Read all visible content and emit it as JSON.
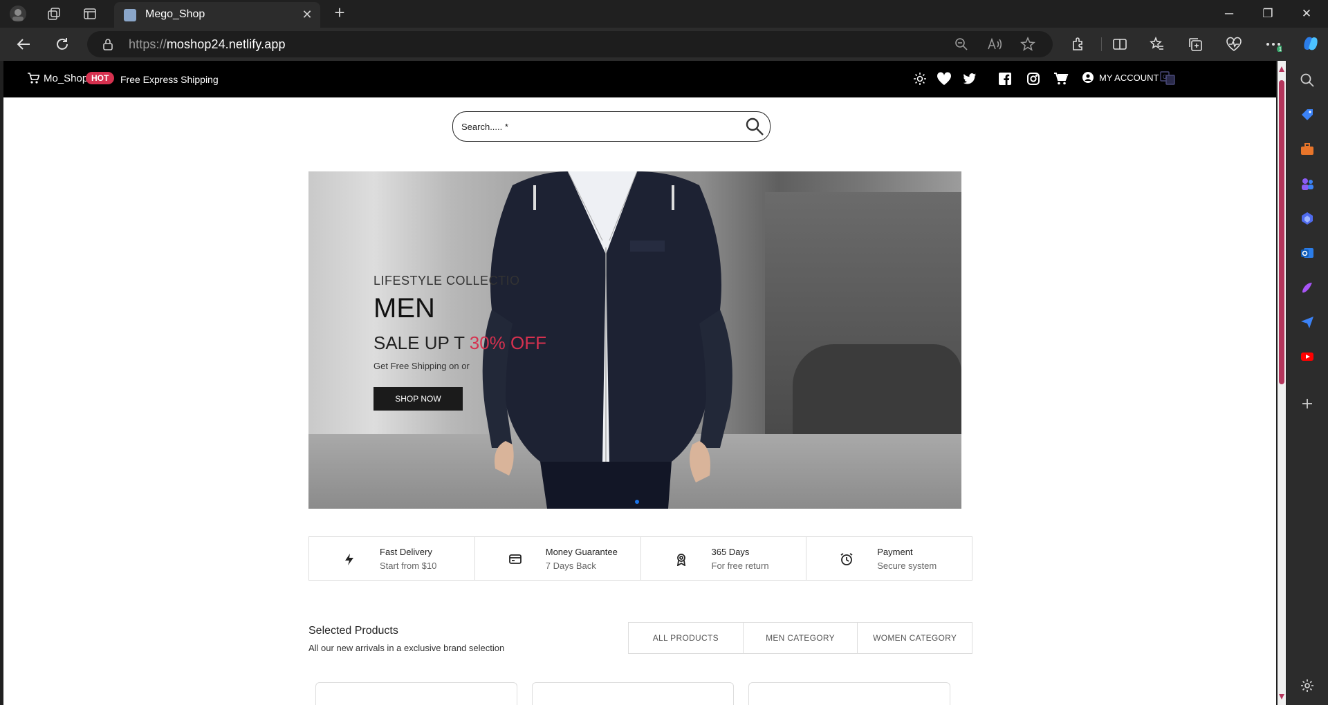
{
  "browser": {
    "tab_title": "Mego_Shop",
    "url_protocol": "https://",
    "url_host": "moshop24.netlify.app",
    "sidebar_badge": "1"
  },
  "header": {
    "brand": "Mo_Shop",
    "hot_badge": "HOT",
    "shipping": "Free Express Shipping",
    "account": "MY ACCOUNT"
  },
  "search": {
    "placeholder": "Search..... *"
  },
  "hero": {
    "subtitle": "LIFESTYLE COLLECTIO",
    "title": "MEN",
    "sale_prefix": "SALE UP T",
    "sale_highlight": "30% OFF",
    "description": "Get Free Shipping on or",
    "button": "SHOP NOW"
  },
  "features": [
    {
      "title": "Fast Delivery",
      "sub": "Start from $10",
      "icon": "bolt-icon"
    },
    {
      "title": "Money Guarantee",
      "sub": "7 Days Back",
      "icon": "card-icon"
    },
    {
      "title": "365 Days",
      "sub": "For free return",
      "icon": "award-icon"
    },
    {
      "title": "Payment",
      "sub": "Secure system",
      "icon": "alarm-icon"
    }
  ],
  "selected": {
    "title": "Selected Products",
    "subtitle": "All our new arrivals in a exclusive brand selection",
    "filters": [
      "ALL PRODUCTS",
      "MEN CATEGORY",
      "WOMEN CATEGORY"
    ]
  },
  "colors": {
    "accent": "#d6314f",
    "nav_bg": "#000000",
    "scroll": "#b4355c"
  }
}
